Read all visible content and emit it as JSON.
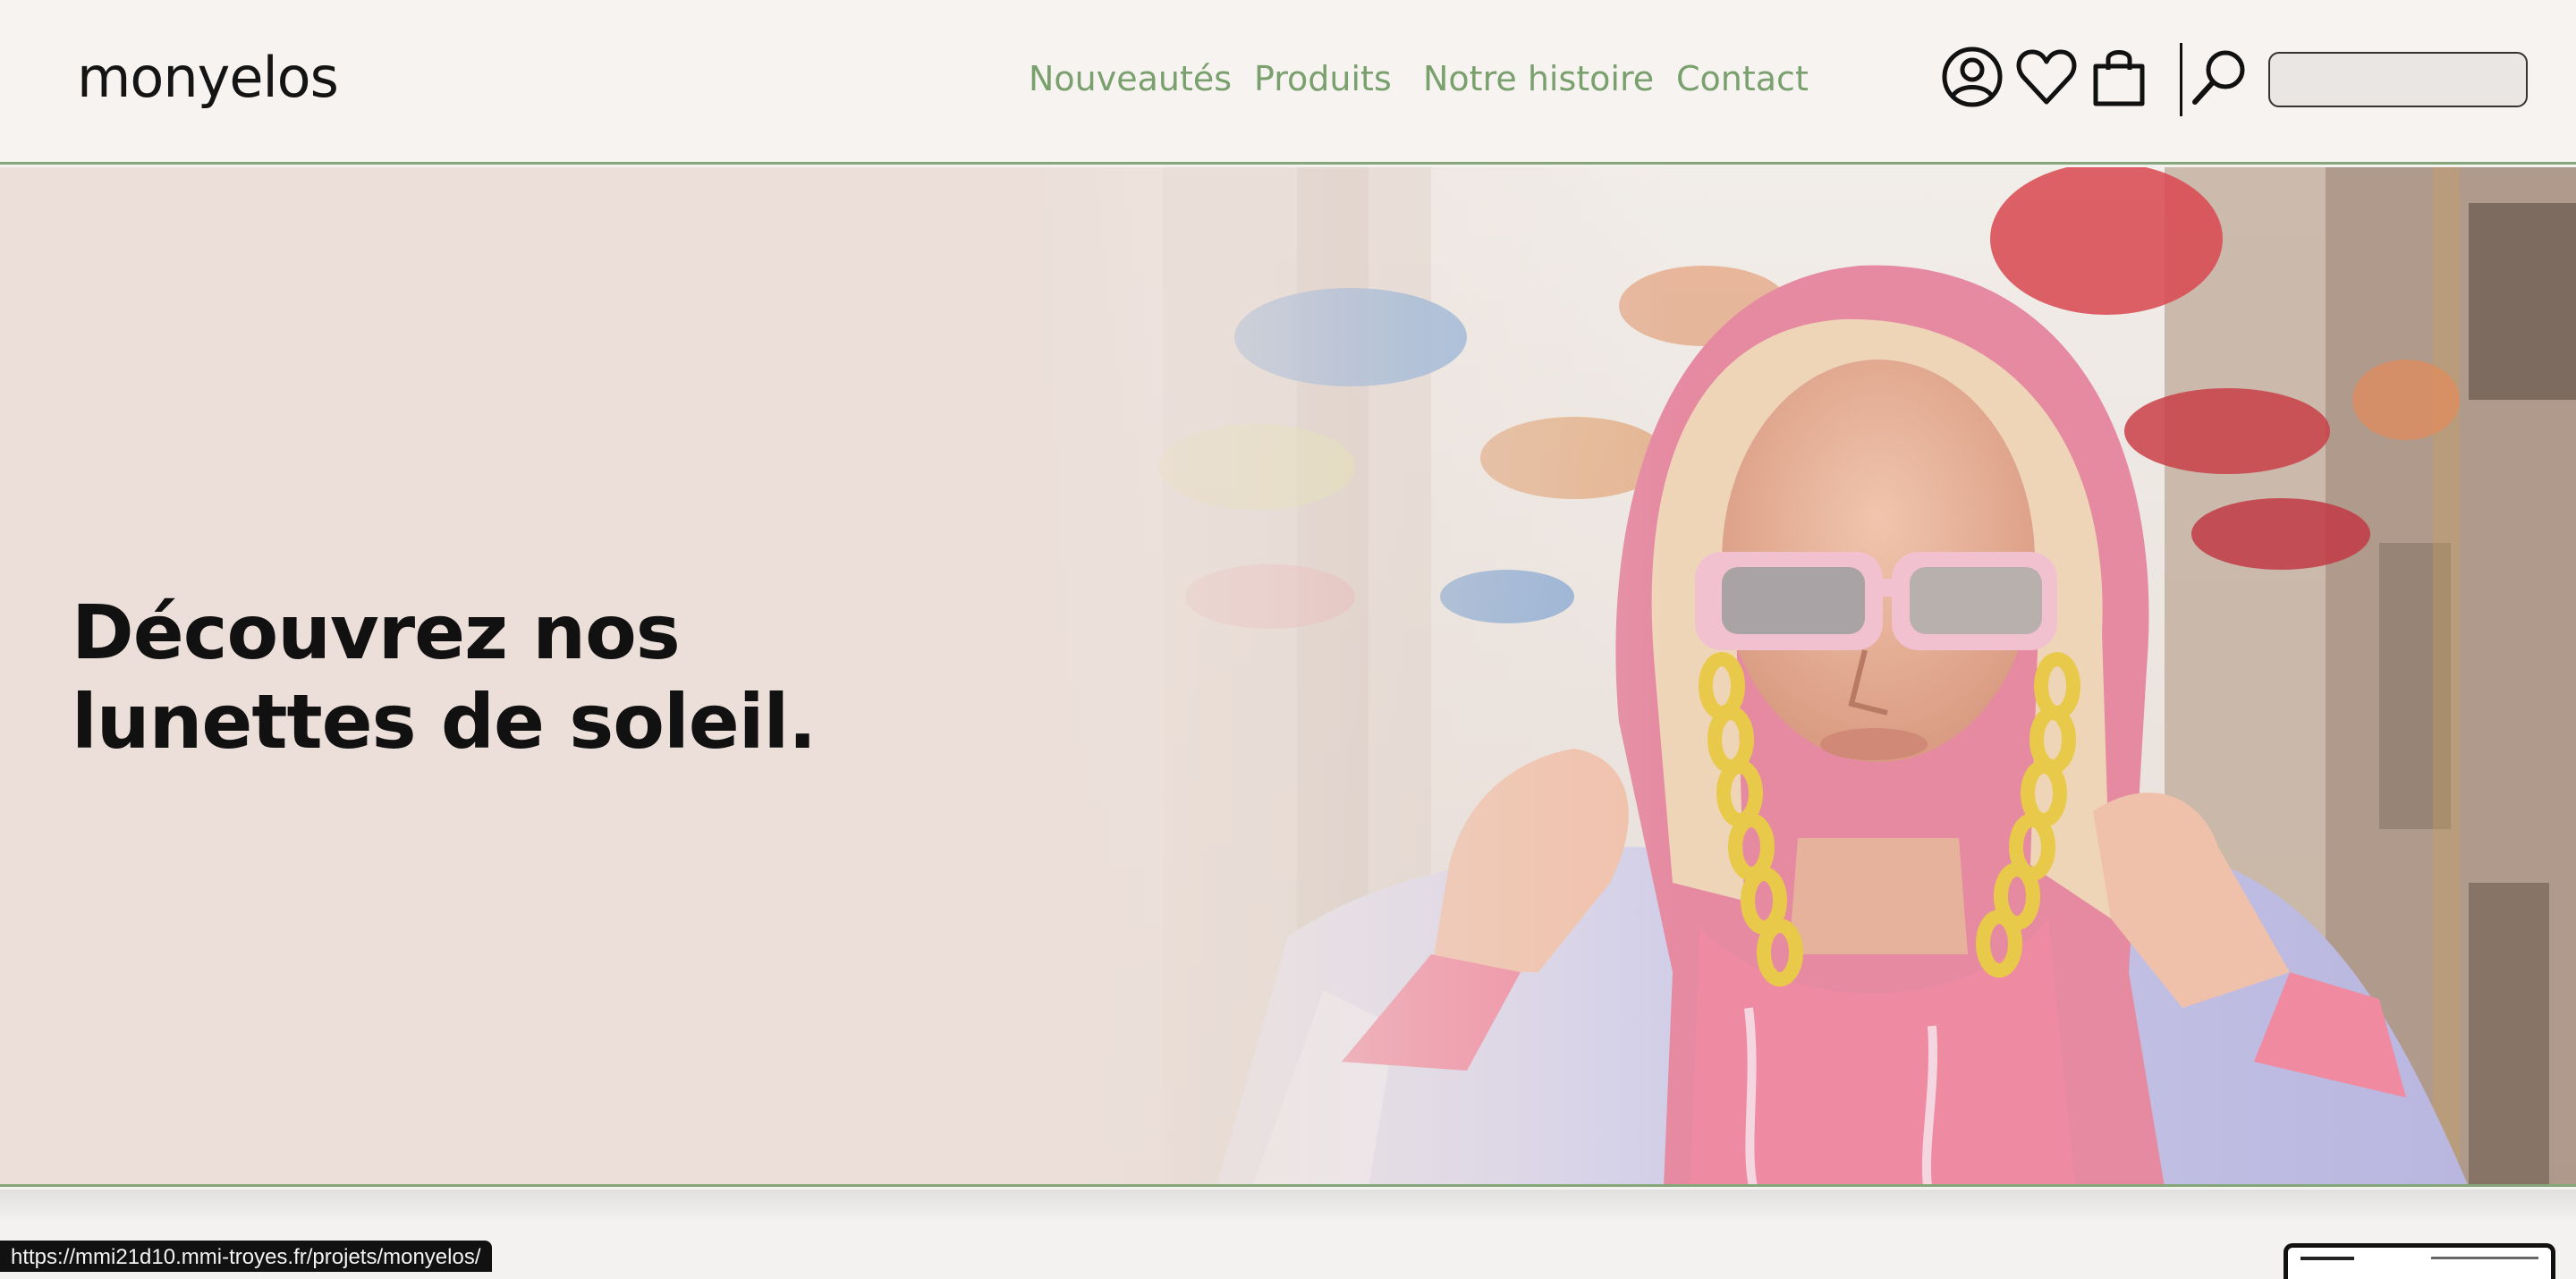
{
  "header": {
    "logo": "monyelos",
    "nav": [
      {
        "label": "Nouveautés"
      },
      {
        "label": "Produits"
      },
      {
        "label": "Notre histoire"
      },
      {
        "label": "Contact"
      }
    ],
    "icons": [
      "account-icon",
      "heart-icon",
      "shopping-bag-icon",
      "search-icon"
    ],
    "search": {
      "value": "",
      "placeholder": ""
    }
  },
  "hero": {
    "title": "Découvrez nos lunettes de soleil.",
    "image": "woman-pink-hoodie-sunglasses-yellow-chain-umbrellas-street"
  },
  "status_bar": {
    "url": "https://mmi21d10.mmi-troyes.fr/projets/monyelos/"
  },
  "colors": {
    "accent_green": "#79a06d",
    "header_bg": "#f6f3f1",
    "hero_bg": "#ecdfd9",
    "text": "#111111"
  }
}
